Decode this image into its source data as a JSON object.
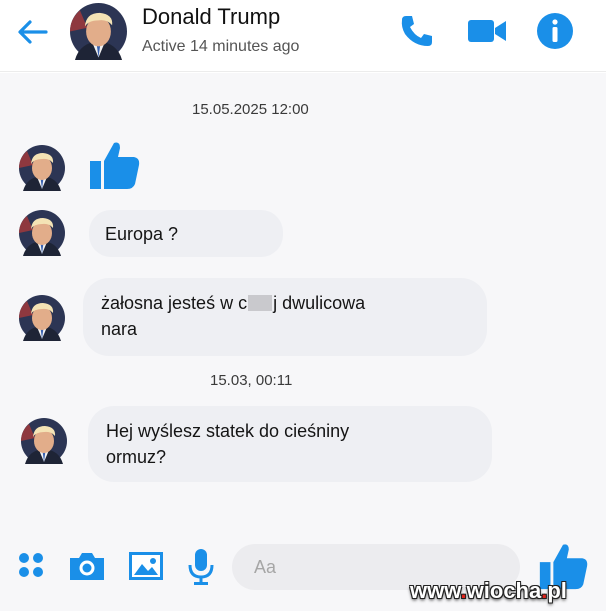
{
  "header": {
    "back_icon": "arrow-left-icon",
    "contact_name": "Donald Trump",
    "status": "Active 14 minutes ago",
    "call_icon": "phone-icon",
    "video_icon": "video-camera-icon",
    "info_icon": "info-icon"
  },
  "colors": {
    "accent": "#1a8fe8",
    "bubble_bg": "#eeeff3",
    "chat_bg": "#f7f7f9"
  },
  "conversation": {
    "timestamps": [
      "15.05.2025 12:00",
      "15.03, 00:11"
    ],
    "messages": [
      {
        "type": "like",
        "icon": "thumbs-up-icon"
      },
      {
        "type": "text",
        "text": "Europa ?"
      },
      {
        "type": "text",
        "text_before": "żałosna jesteś w c",
        "text_after": "j dwulicowa",
        "line2": "nara"
      },
      {
        "type": "text",
        "line1": "Hej wyślesz statek do cieśniny",
        "line2": "ormuz?"
      }
    ]
  },
  "composer": {
    "menu_icon": "four-dots-icon",
    "camera_icon": "camera-icon",
    "image_icon": "image-icon",
    "mic_icon": "microphone-icon",
    "placeholder": "Aa",
    "send_icon": "thumbs-up-icon"
  },
  "watermark": {
    "part1": "www",
    "dot1": ".",
    "part2": "wiocha",
    "dot2": ".",
    "part3": "pl"
  }
}
